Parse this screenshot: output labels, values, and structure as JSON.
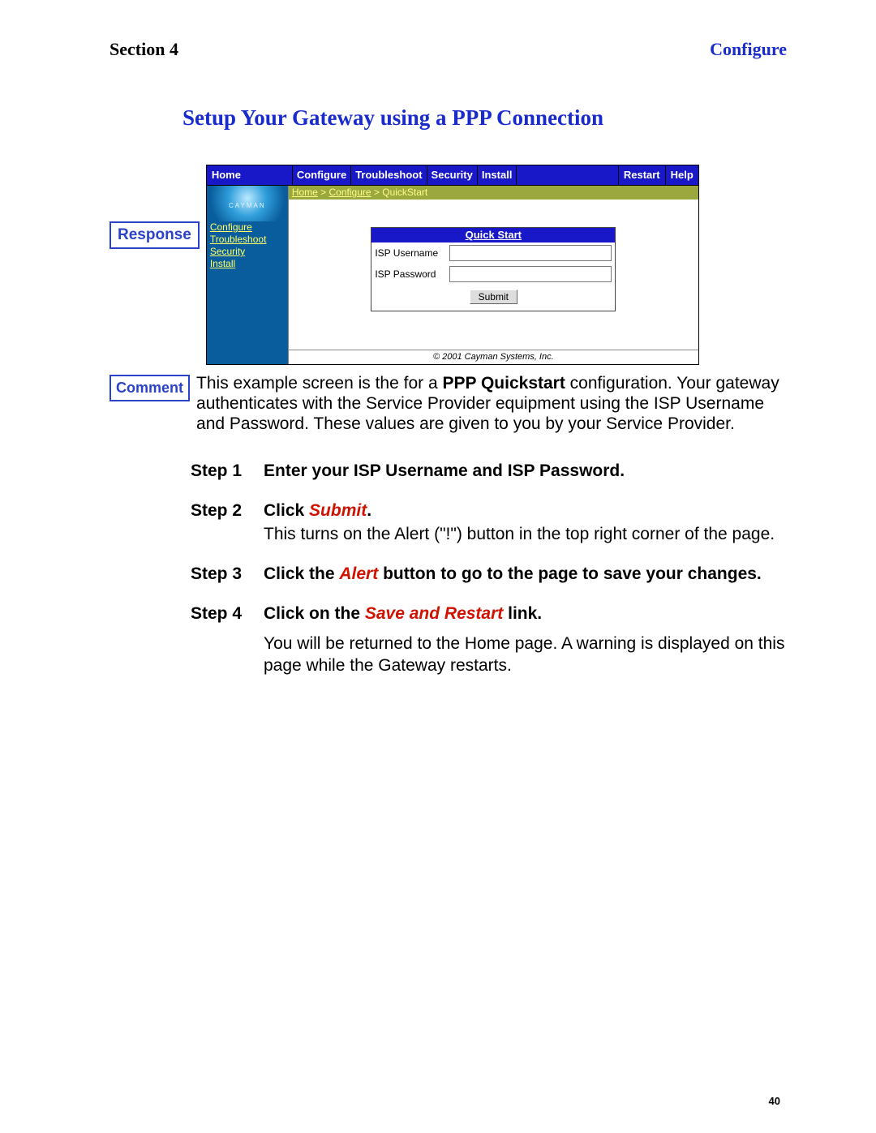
{
  "header": {
    "left": "Section 4",
    "right": "Configure"
  },
  "title": "Setup Your Gateway using a PPP Connection",
  "labels": {
    "response": "Response",
    "comment": "Comment"
  },
  "screenshot": {
    "topnav": {
      "home": "Home",
      "items": [
        "Configure",
        "Troubleshoot",
        "Security",
        "Install"
      ],
      "restart": "Restart",
      "help": "Help"
    },
    "sidebar": {
      "brand": "CAYMAN",
      "links": [
        "Configure",
        "Troubleshoot",
        "Security",
        "Install"
      ]
    },
    "breadcrumb": {
      "a": "Home",
      "b": "Configure",
      "c": "QuickStart",
      "sep": " > "
    },
    "quickstart": {
      "head": "Quick Start",
      "user_label": "ISP Username",
      "pass_label": "ISP Password",
      "submit": "Submit"
    },
    "footer": "© 2001 Cayman Systems, Inc."
  },
  "comment_text": {
    "pre": "This example screen is the for a ",
    "bold": "PPP Quickstart",
    "post": " configuration. Your gateway authenticates with the Service Provider equipment using the ISP Username and Password. These values are given to you by your Service Provider."
  },
  "steps": [
    {
      "label": "Step 1",
      "bold": "Enter your ISP Username and ISP Password."
    },
    {
      "label": "Step 2",
      "bold_pre": "Click ",
      "red": "Submit",
      "bold_post": ".",
      "plain": "This turns on the Alert (\"!\") button in the top right corner of the page."
    },
    {
      "label": "Step 3",
      "bold_pre": "Click the ",
      "red": "Alert",
      "bold_post": " button to go to the page to save your changes."
    },
    {
      "label": "Step 4",
      "bold_pre": "Click on the ",
      "red": "Save and Restart",
      "bold_post": " link."
    }
  ],
  "after_steps": "You will be returned to the Home page. A warning is displayed on this page while the Gateway restarts.",
  "page_number": "40"
}
